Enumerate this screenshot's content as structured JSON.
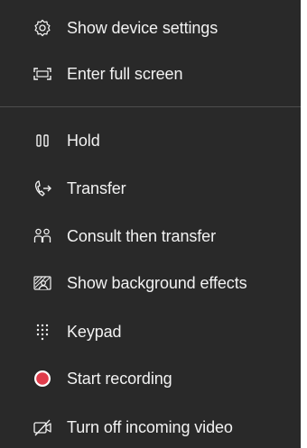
{
  "menu": {
    "items": [
      {
        "label": "Show device settings",
        "icon": "gear-icon"
      },
      {
        "label": "Enter full screen",
        "icon": "full-screen-icon"
      },
      {
        "label": "Hold",
        "icon": "pause-icon"
      },
      {
        "label": "Transfer",
        "icon": "transfer-icon"
      },
      {
        "label": "Consult then transfer",
        "icon": "consult-icon"
      },
      {
        "label": "Show background effects",
        "icon": "background-effects-icon"
      },
      {
        "label": "Keypad",
        "icon": "keypad-icon"
      },
      {
        "label": "Start recording",
        "icon": "record-icon"
      },
      {
        "label": "Turn off incoming video",
        "icon": "video-off-icon"
      }
    ]
  },
  "colors": {
    "menu_background": "#292929",
    "text": "#f2f2f2",
    "divider": "#4d4d4d",
    "record": "#e03c4b"
  }
}
